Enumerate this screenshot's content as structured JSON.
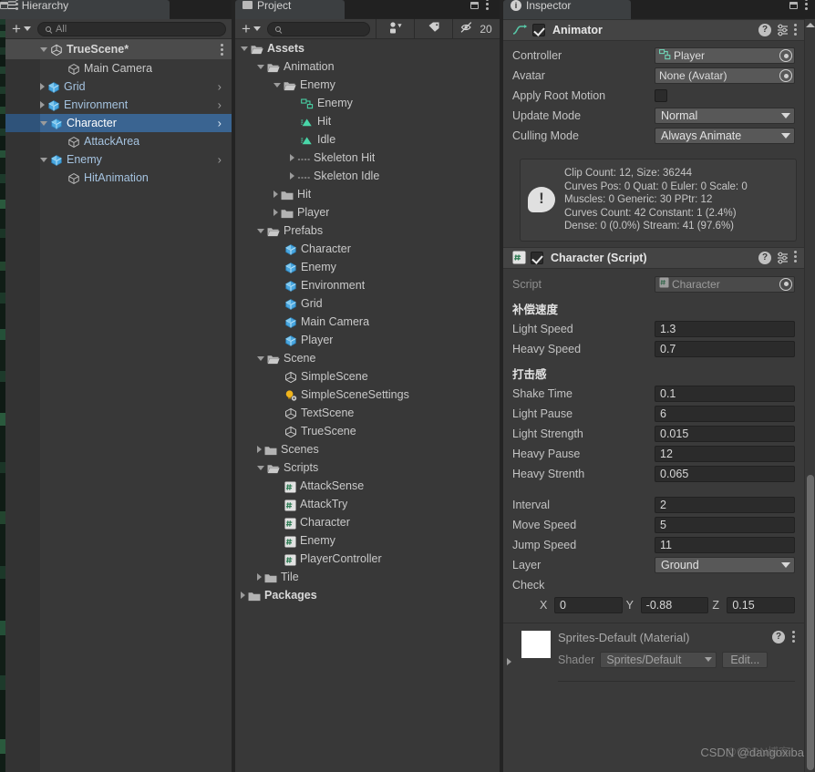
{
  "hierarchy": {
    "tab_label": "Hierarchy",
    "tab_icon": "hierarchy-icon",
    "toolbar": {
      "add_label": "+",
      "search_placeholder": "All",
      "search_value": "All"
    },
    "scene_root": {
      "label": "TrueScene*",
      "icon": "unity-scene-icon",
      "expanded": true
    },
    "items": [
      {
        "label": "Main Camera",
        "icon": "gameobject-icon",
        "indent": 2,
        "twisty": "none",
        "selected": false,
        "prefab": false,
        "chevron": false
      },
      {
        "label": "Grid",
        "icon": "prefab-icon",
        "indent": 1,
        "twisty": "closed",
        "selected": false,
        "prefab": true,
        "chevron": true
      },
      {
        "label": "Environment",
        "icon": "prefab-icon",
        "indent": 1,
        "twisty": "closed",
        "selected": false,
        "prefab": true,
        "chevron": true
      },
      {
        "label": "Character",
        "icon": "prefab-icon",
        "indent": 1,
        "twisty": "open",
        "selected": true,
        "prefab": true,
        "chevron": true
      },
      {
        "label": "AttackArea",
        "icon": "gameobject-icon",
        "indent": 2,
        "twisty": "none",
        "selected": false,
        "prefab": true,
        "chevron": false
      },
      {
        "label": "Enemy",
        "icon": "prefab-icon",
        "indent": 1,
        "twisty": "open",
        "selected": false,
        "prefab": true,
        "chevron": true
      },
      {
        "label": "HitAnimation",
        "icon": "gameobject-icon",
        "indent": 2,
        "twisty": "none",
        "selected": false,
        "prefab": true,
        "chevron": false
      }
    ]
  },
  "project": {
    "tab_label": "Project",
    "tab_icon": "project-icon",
    "toolbar": {
      "add_label": "+",
      "search_placeholder": "",
      "search_value": "",
      "filter_type_icon": "type-filter-icon",
      "filter_label_icon": "label-filter-icon",
      "hidden_icon": "eye-off-icon",
      "hidden_count": "20"
    },
    "items": [
      {
        "label": "Assets",
        "icon": "folder-open-icon",
        "indent": 0,
        "twisty": "open",
        "bold": true
      },
      {
        "label": "Animation",
        "icon": "folder-open-icon",
        "indent": 1,
        "twisty": "open",
        "bold": false
      },
      {
        "label": "Enemy",
        "icon": "folder-open-icon",
        "indent": 2,
        "twisty": "open",
        "bold": false
      },
      {
        "label": "Enemy",
        "icon": "animator-controller-icon",
        "indent": 3,
        "twisty": "none",
        "bold": false
      },
      {
        "label": "Hit",
        "icon": "animation-clip-icon",
        "indent": 3,
        "twisty": "none",
        "bold": false
      },
      {
        "label": "Idle",
        "icon": "animation-clip-icon",
        "indent": 3,
        "twisty": "none",
        "bold": false
      },
      {
        "label": "Skeleton Hit",
        "icon": "sprite-sheet-icon",
        "indent": 3,
        "twisty": "closed",
        "bold": false
      },
      {
        "label": "Skeleton Idle",
        "icon": "sprite-sheet-icon",
        "indent": 3,
        "twisty": "closed",
        "bold": false
      },
      {
        "label": "Hit",
        "icon": "folder-icon",
        "indent": 2,
        "twisty": "closed",
        "bold": false
      },
      {
        "label": "Player",
        "icon": "folder-icon",
        "indent": 2,
        "twisty": "closed",
        "bold": false
      },
      {
        "label": "Prefabs",
        "icon": "folder-open-icon",
        "indent": 1,
        "twisty": "open",
        "bold": false
      },
      {
        "label": "Character",
        "icon": "prefab-icon",
        "indent": 2,
        "twisty": "none",
        "bold": false
      },
      {
        "label": "Enemy",
        "icon": "prefab-icon",
        "indent": 2,
        "twisty": "none",
        "bold": false
      },
      {
        "label": "Environment",
        "icon": "prefab-icon",
        "indent": 2,
        "twisty": "none",
        "bold": false
      },
      {
        "label": "Grid",
        "icon": "prefab-icon",
        "indent": 2,
        "twisty": "none",
        "bold": false
      },
      {
        "label": "Main Camera",
        "icon": "prefab-icon",
        "indent": 2,
        "twisty": "none",
        "bold": false
      },
      {
        "label": "Player",
        "icon": "prefab-icon",
        "indent": 2,
        "twisty": "none",
        "bold": false
      },
      {
        "label": "Scene",
        "icon": "folder-open-icon",
        "indent": 1,
        "twisty": "open",
        "bold": false
      },
      {
        "label": "SimpleScene",
        "icon": "unity-scene-icon",
        "indent": 2,
        "twisty": "none",
        "bold": false
      },
      {
        "label": "SimpleSceneSettings",
        "icon": "lighting-settings-icon",
        "indent": 2,
        "twisty": "none",
        "bold": false
      },
      {
        "label": "TextScene",
        "icon": "unity-scene-icon",
        "indent": 2,
        "twisty": "none",
        "bold": false
      },
      {
        "label": "TrueScene",
        "icon": "unity-scene-icon",
        "indent": 2,
        "twisty": "none",
        "bold": false
      },
      {
        "label": "Scenes",
        "icon": "folder-icon",
        "indent": 1,
        "twisty": "closed",
        "bold": false
      },
      {
        "label": "Scripts",
        "icon": "folder-open-icon",
        "indent": 1,
        "twisty": "open",
        "bold": false
      },
      {
        "label": "AttackSense",
        "icon": "csharp-script-icon",
        "indent": 2,
        "twisty": "none",
        "bold": false
      },
      {
        "label": "AttackTry",
        "icon": "csharp-script-icon",
        "indent": 2,
        "twisty": "none",
        "bold": false
      },
      {
        "label": "Character",
        "icon": "csharp-script-icon",
        "indent": 2,
        "twisty": "none",
        "bold": false
      },
      {
        "label": "Enemy",
        "icon": "csharp-script-icon",
        "indent": 2,
        "twisty": "none",
        "bold": false
      },
      {
        "label": "PlayerController",
        "icon": "csharp-script-icon",
        "indent": 2,
        "twisty": "none",
        "bold": false
      },
      {
        "label": "Tile",
        "icon": "folder-icon",
        "indent": 1,
        "twisty": "closed",
        "bold": false
      },
      {
        "label": "Packages",
        "icon": "folder-icon",
        "indent": 0,
        "twisty": "closed",
        "bold": true
      }
    ]
  },
  "inspector": {
    "tab_label": "Inspector",
    "tab_icon": "inspector-info-icon",
    "animator": {
      "title": "Animator",
      "icon": "animator-icon",
      "enabled": true,
      "controller_label": "Controller",
      "controller_value": "Player",
      "avatar_label": "Avatar",
      "avatar_value": "None (Avatar)",
      "apply_root_motion_label": "Apply Root Motion",
      "apply_root_motion_checked": false,
      "update_mode_label": "Update Mode",
      "update_mode_value": "Normal",
      "culling_mode_label": "Culling Mode",
      "culling_mode_value": "Always Animate",
      "info_lines": [
        "Clip Count: 12, Size: 36244",
        "Curves Pos: 0 Quat: 0 Euler: 0 Scale: 0",
        "Muscles: 0 Generic: 30 PPtr: 12",
        "Curves Count: 42 Constant: 1 (2.4%)",
        "Dense: 0 (0.0%) Stream: 41 (97.6%)"
      ]
    },
    "character_script": {
      "title": "Character (Script)",
      "icon": "csharp-script-icon",
      "enabled": true,
      "script_label": "Script",
      "script_value": "Character",
      "group_speed": "补偿速度",
      "group_hit": "打击感",
      "fields": [
        {
          "label": "Light Speed",
          "value": "1.3"
        },
        {
          "label": "Heavy Speed",
          "value": "0.7"
        }
      ],
      "hit_fields": [
        {
          "label": "Shake Time",
          "value": "0.1"
        },
        {
          "label": "Light Pause",
          "value": "6"
        },
        {
          "label": "Light Strength",
          "value": "0.015"
        },
        {
          "label": "Heavy Pause",
          "value": "12"
        },
        {
          "label": "Heavy Strenth",
          "value": "0.065"
        }
      ],
      "move_fields": [
        {
          "label": "Interval",
          "value": "2"
        },
        {
          "label": "Move Speed",
          "value": "5"
        },
        {
          "label": "Jump Speed",
          "value": "11"
        }
      ],
      "layer_label": "Layer",
      "layer_value": "Ground",
      "check_label": "Check",
      "check_axes": [
        {
          "axis": "X",
          "value": "0"
        },
        {
          "axis": "Y",
          "value": "-0.88"
        },
        {
          "axis": "Z",
          "value": "0.15"
        }
      ]
    },
    "material": {
      "title": "Sprites-Default (Material)",
      "shader_label": "Shader",
      "shader_value": "Sprites/Default",
      "edit_label": "Edit..."
    }
  },
  "watermark": {
    "text": "CSDN @dangoxiba",
    "cjk": "@CSDN博客"
  }
}
